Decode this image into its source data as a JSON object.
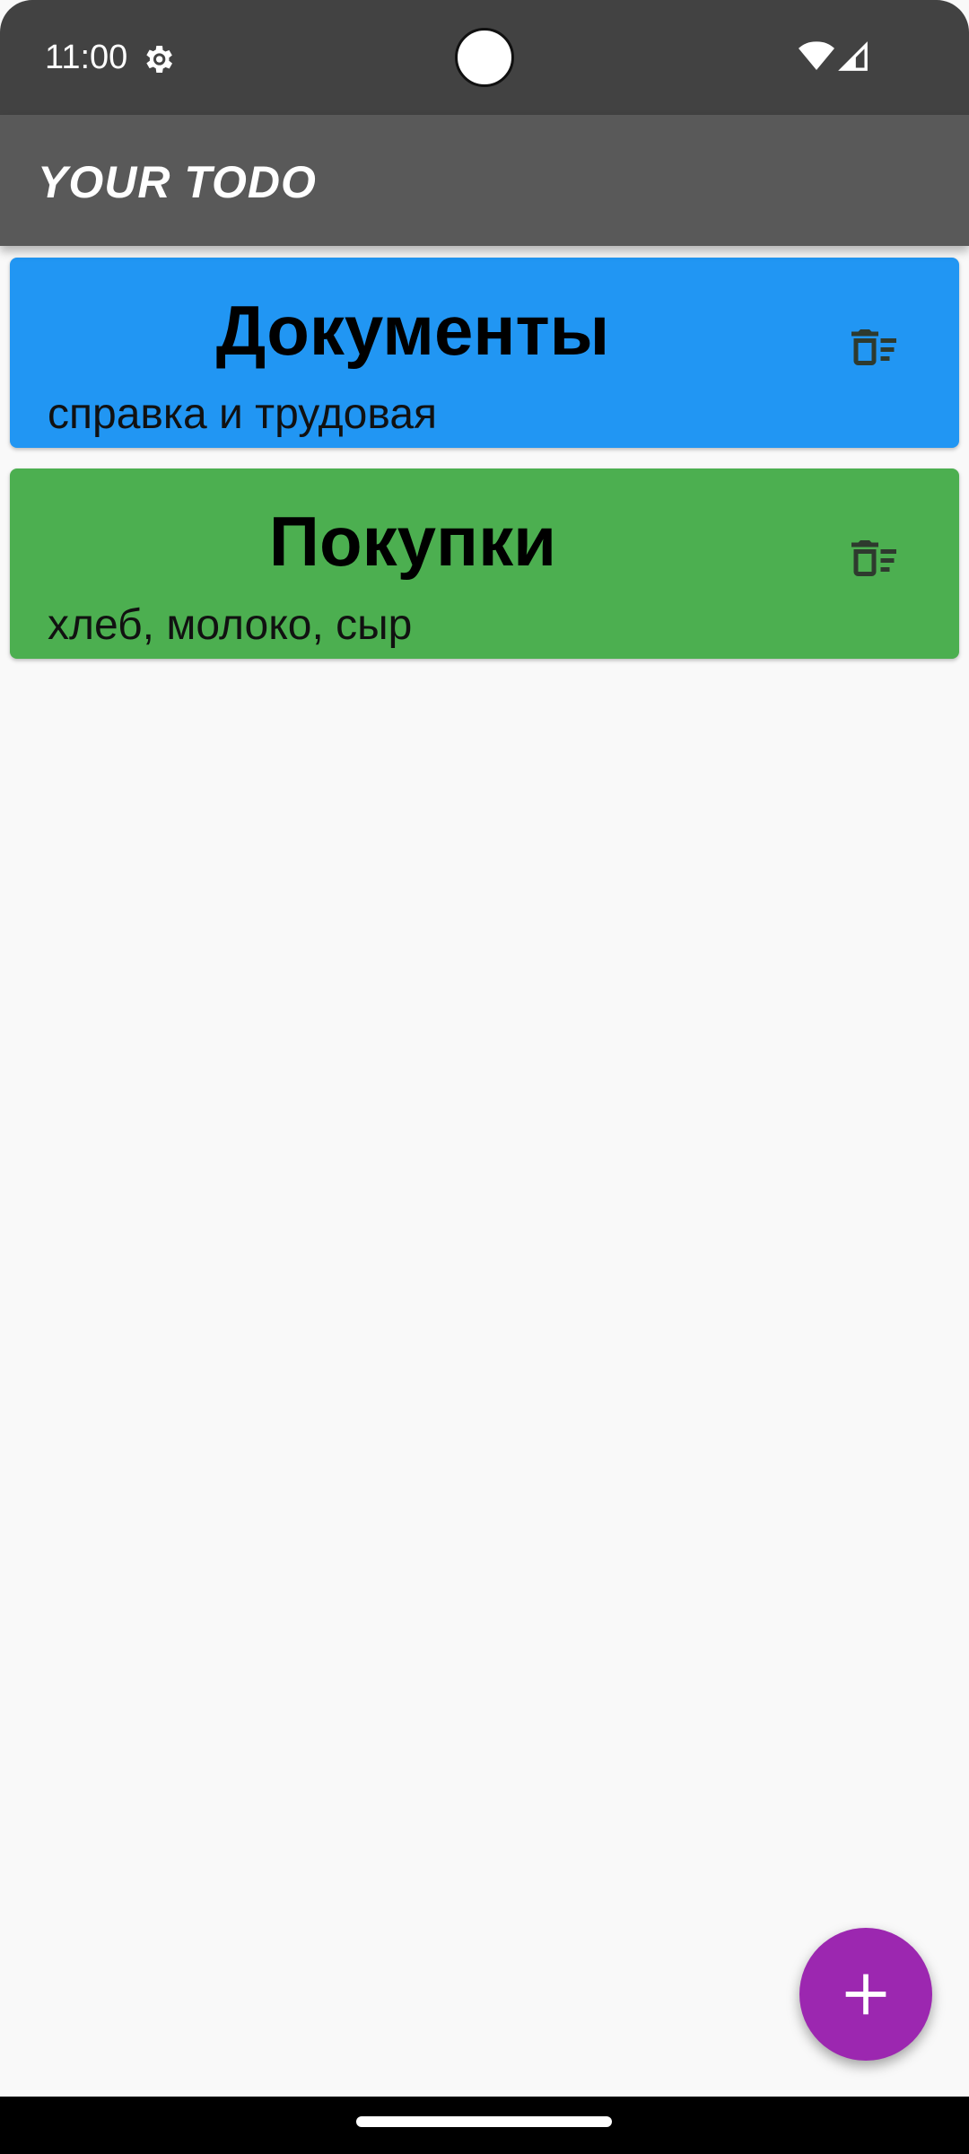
{
  "status_bar": {
    "time": "11:00",
    "icons": [
      "settings-gear-icon",
      "camera-cutout",
      "wifi-icon",
      "cell-signal-icon"
    ]
  },
  "app_bar": {
    "title": "YOUR TODO"
  },
  "todos": [
    {
      "title": "Документы",
      "description": "справка и трудовая",
      "color": "#2196f3",
      "icon": "delete-sweep-icon"
    },
    {
      "title": "Покупки",
      "description": "хлеб, молоко, сыр",
      "color": "#4caf50",
      "icon": "delete-sweep-icon"
    }
  ],
  "fab": {
    "icon": "plus-icon",
    "color": "#9c27b0"
  },
  "theme": {
    "status_bar": "#424242",
    "app_bar": "#595959",
    "background": "#f9f9f9",
    "delete_icon": "#2e3a2e"
  }
}
